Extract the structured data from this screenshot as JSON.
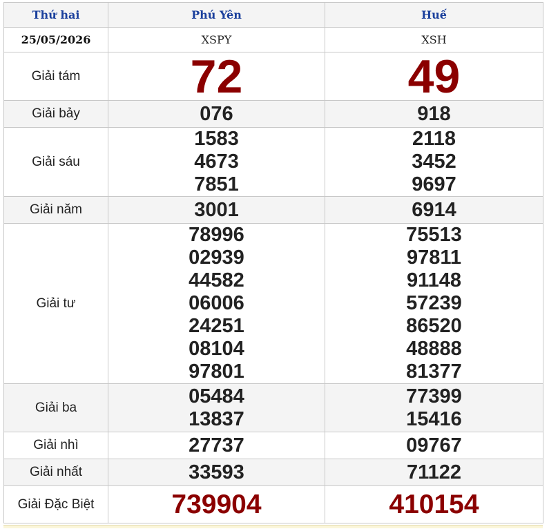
{
  "header": {
    "day": "Thứ hai",
    "province_1": "Phú Yên",
    "province_2": "Huế"
  },
  "codes": {
    "date": "25/05/2026",
    "code_1": "XSPY",
    "code_2": "XSH"
  },
  "prizes": [
    {
      "label": "Giải tám",
      "p1": [
        "72"
      ],
      "p2": [
        "49"
      ]
    },
    {
      "label": "Giải bảy",
      "p1": [
        "076"
      ],
      "p2": [
        "918"
      ]
    },
    {
      "label": "Giải sáu",
      "p1": [
        "1583",
        "4673",
        "7851"
      ],
      "p2": [
        "2118",
        "3452",
        "9697"
      ]
    },
    {
      "label": "Giải năm",
      "p1": [
        "3001"
      ],
      "p2": [
        "6914"
      ]
    },
    {
      "label": "Giải tư",
      "p1": [
        "78996",
        "02939",
        "44582",
        "06006",
        "24251",
        "08104",
        "97801"
      ],
      "p2": [
        "75513",
        "97811",
        "91148",
        "57239",
        "86520",
        "48888",
        "81377"
      ]
    },
    {
      "label": "Giải ba",
      "p1": [
        "05484",
        "13837"
      ],
      "p2": [
        "77399",
        "15416"
      ]
    },
    {
      "label": "Giải nhì",
      "p1": [
        "27737"
      ],
      "p2": [
        "09767"
      ]
    },
    {
      "label": "Giải nhất",
      "p1": [
        "33593"
      ],
      "p2": [
        "71122"
      ]
    },
    {
      "label": "Giải Đặc Biệt",
      "p1": [
        "739904"
      ],
      "p2": [
        "410154"
      ]
    }
  ],
  "colors": {
    "header_text": "#1a3f9c",
    "highlight_red": "#8b0000",
    "row_alt": "#f4f4f4"
  }
}
